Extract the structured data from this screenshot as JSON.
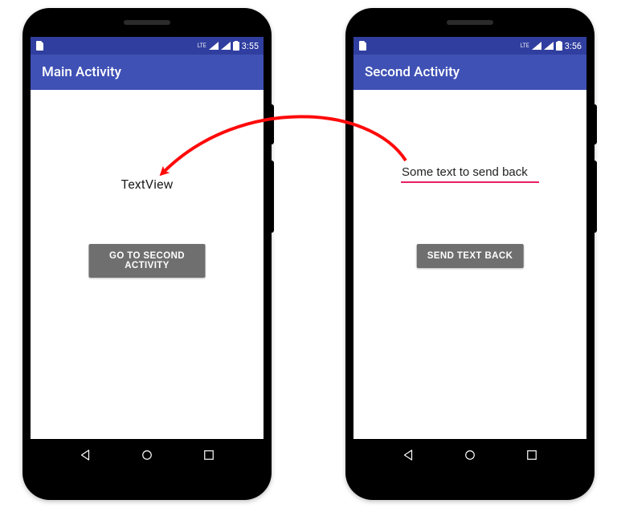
{
  "colors": {
    "status_bar_bg": "#303f9f",
    "app_bar_bg": "#3f51b5",
    "button_bg": "#6f6f6f",
    "accent_pink": "#e91e63",
    "arrow_red": "#ff0a0a"
  },
  "left_phone": {
    "status": {
      "time": "3:55",
      "lte_label": "LTE"
    },
    "app_bar_title": "Main Activity",
    "text_view": "TextView",
    "button_label": "GO TO SECOND ACTIVITY"
  },
  "right_phone": {
    "status": {
      "time": "3:56",
      "lte_label": "LTE"
    },
    "app_bar_title": "Second Activity",
    "edit_text_value": "Some text to send back",
    "button_label": "SEND TEXT BACK"
  },
  "icons": {
    "sim_card": "sim-card-icon",
    "signal_1": "signal-icon",
    "signal_2": "signal-icon",
    "battery": "battery-icon",
    "nav_back": "nav-back-icon",
    "nav_home": "nav-home-icon",
    "nav_recent": "nav-recent-icon"
  }
}
